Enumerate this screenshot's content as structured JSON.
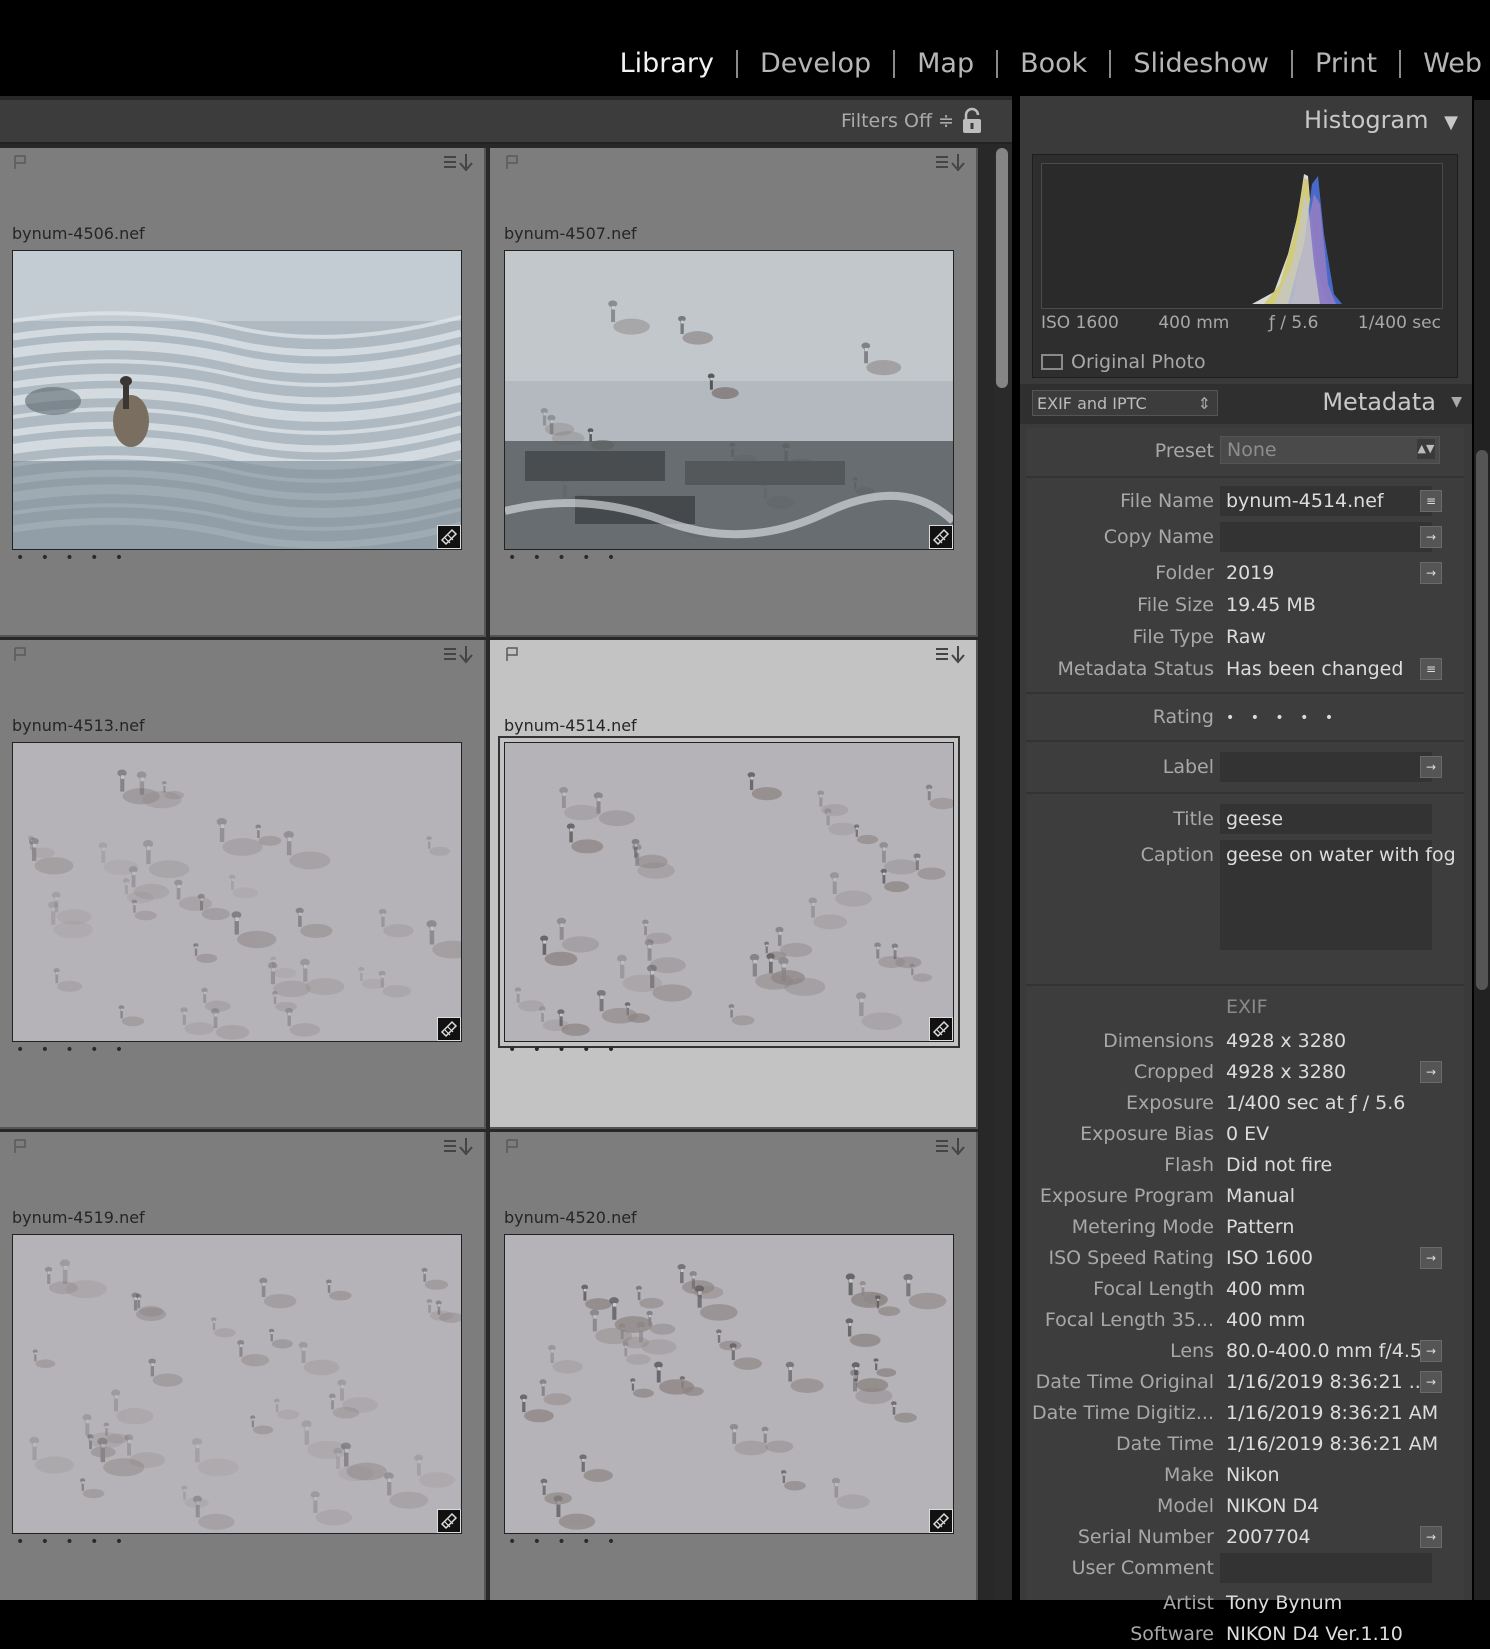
{
  "modules": [
    "Library",
    "Develop",
    "Map",
    "Book",
    "Slideshow",
    "Print",
    "Web"
  ],
  "filter_bar": {
    "label": "Filters Off ≑"
  },
  "grid": {
    "cells": [
      {
        "filename": "bynum-4506.nef",
        "stars": "• • • • •",
        "scene": "waterfall"
      },
      {
        "filename": "bynum-4507.nef",
        "stars": "• • • • •",
        "scene": "rocks"
      },
      {
        "filename": "bynum-4513.nef",
        "stars": "• • • • •",
        "scene": "flock"
      },
      {
        "filename": "bynum-4514.nef",
        "stars": "• • • • •",
        "scene": "flock",
        "selected": true
      },
      {
        "filename": "bynum-4519.nef",
        "stars": "• • • • •",
        "scene": "flock"
      },
      {
        "filename": "bynum-4520.nef",
        "stars": "• • • • •",
        "scene": "flock"
      }
    ]
  },
  "histogram": {
    "title": "Histogram",
    "iso": "ISO 1600",
    "focal": "400 mm",
    "aperture": "ƒ / 5.6",
    "shutter": "1/400 sec",
    "original_photo": "Original Photo"
  },
  "metadata": {
    "view_select": "EXIF and IPTC",
    "title": "Metadata",
    "preset_label": "Preset",
    "preset_value": "None",
    "file_name_label": "File Name",
    "file_name": "bynum-4514.nef",
    "copy_name_label": "Copy Name",
    "folder_label": "Folder",
    "folder": "2019",
    "file_size_label": "File Size",
    "file_size": "19.45 MB",
    "file_type_label": "File Type",
    "file_type": "Raw",
    "metadata_status_label": "Metadata Status",
    "metadata_status": "Has been changed",
    "rating_label": "Rating",
    "rating": "• • • • •",
    "label_label": "Label",
    "title_label": "Title",
    "title_value": "geese",
    "caption_label": "Caption",
    "caption_value": "geese on water with fog",
    "exif_heading": "EXIF",
    "exif": [
      {
        "label": "Dimensions",
        "value": "4928 x 3280",
        "btn": false
      },
      {
        "label": "Cropped",
        "value": "4928 x 3280",
        "btn": true
      },
      {
        "label": "Exposure",
        "value": "1/400 sec at ƒ / 5.6",
        "btn": false
      },
      {
        "label": "Exposure Bias",
        "value": "0 EV",
        "btn": false
      },
      {
        "label": "Flash",
        "value": "Did not fire",
        "btn": false
      },
      {
        "label": "Exposure Program",
        "value": "Manual",
        "btn": false
      },
      {
        "label": "Metering Mode",
        "value": "Pattern",
        "btn": false
      },
      {
        "label": "ISO Speed Rating",
        "value": "ISO 1600",
        "btn": true
      },
      {
        "label": "Focal Length",
        "value": "400 mm",
        "btn": false
      },
      {
        "label": "Focal Length 35...",
        "value": "400 mm",
        "btn": false
      },
      {
        "label": "Lens",
        "value": "80.0-400.0 mm f/4.5-",
        "btn": true
      },
      {
        "label": "Date Time Original",
        "value": "1/16/2019 8:36:21 ...",
        "btn": true
      },
      {
        "label": "Date Time Digitiz...",
        "value": "1/16/2019 8:36:21 AM",
        "btn": false
      },
      {
        "label": "Date Time",
        "value": "1/16/2019 8:36:21 AM",
        "btn": false
      },
      {
        "label": "Make",
        "value": "Nikon",
        "btn": false
      },
      {
        "label": "Model",
        "value": "NIKON D4",
        "btn": false
      },
      {
        "label": "Serial Number",
        "value": "2007704",
        "btn": true
      },
      {
        "label": "User Comment",
        "value": "",
        "btn": false,
        "field": true
      },
      {
        "label": "Artist",
        "value": "Tony Bynum",
        "btn": false
      },
      {
        "label": "Software",
        "value": "NIKON D4 Ver.1.10",
        "btn": false
      }
    ]
  }
}
